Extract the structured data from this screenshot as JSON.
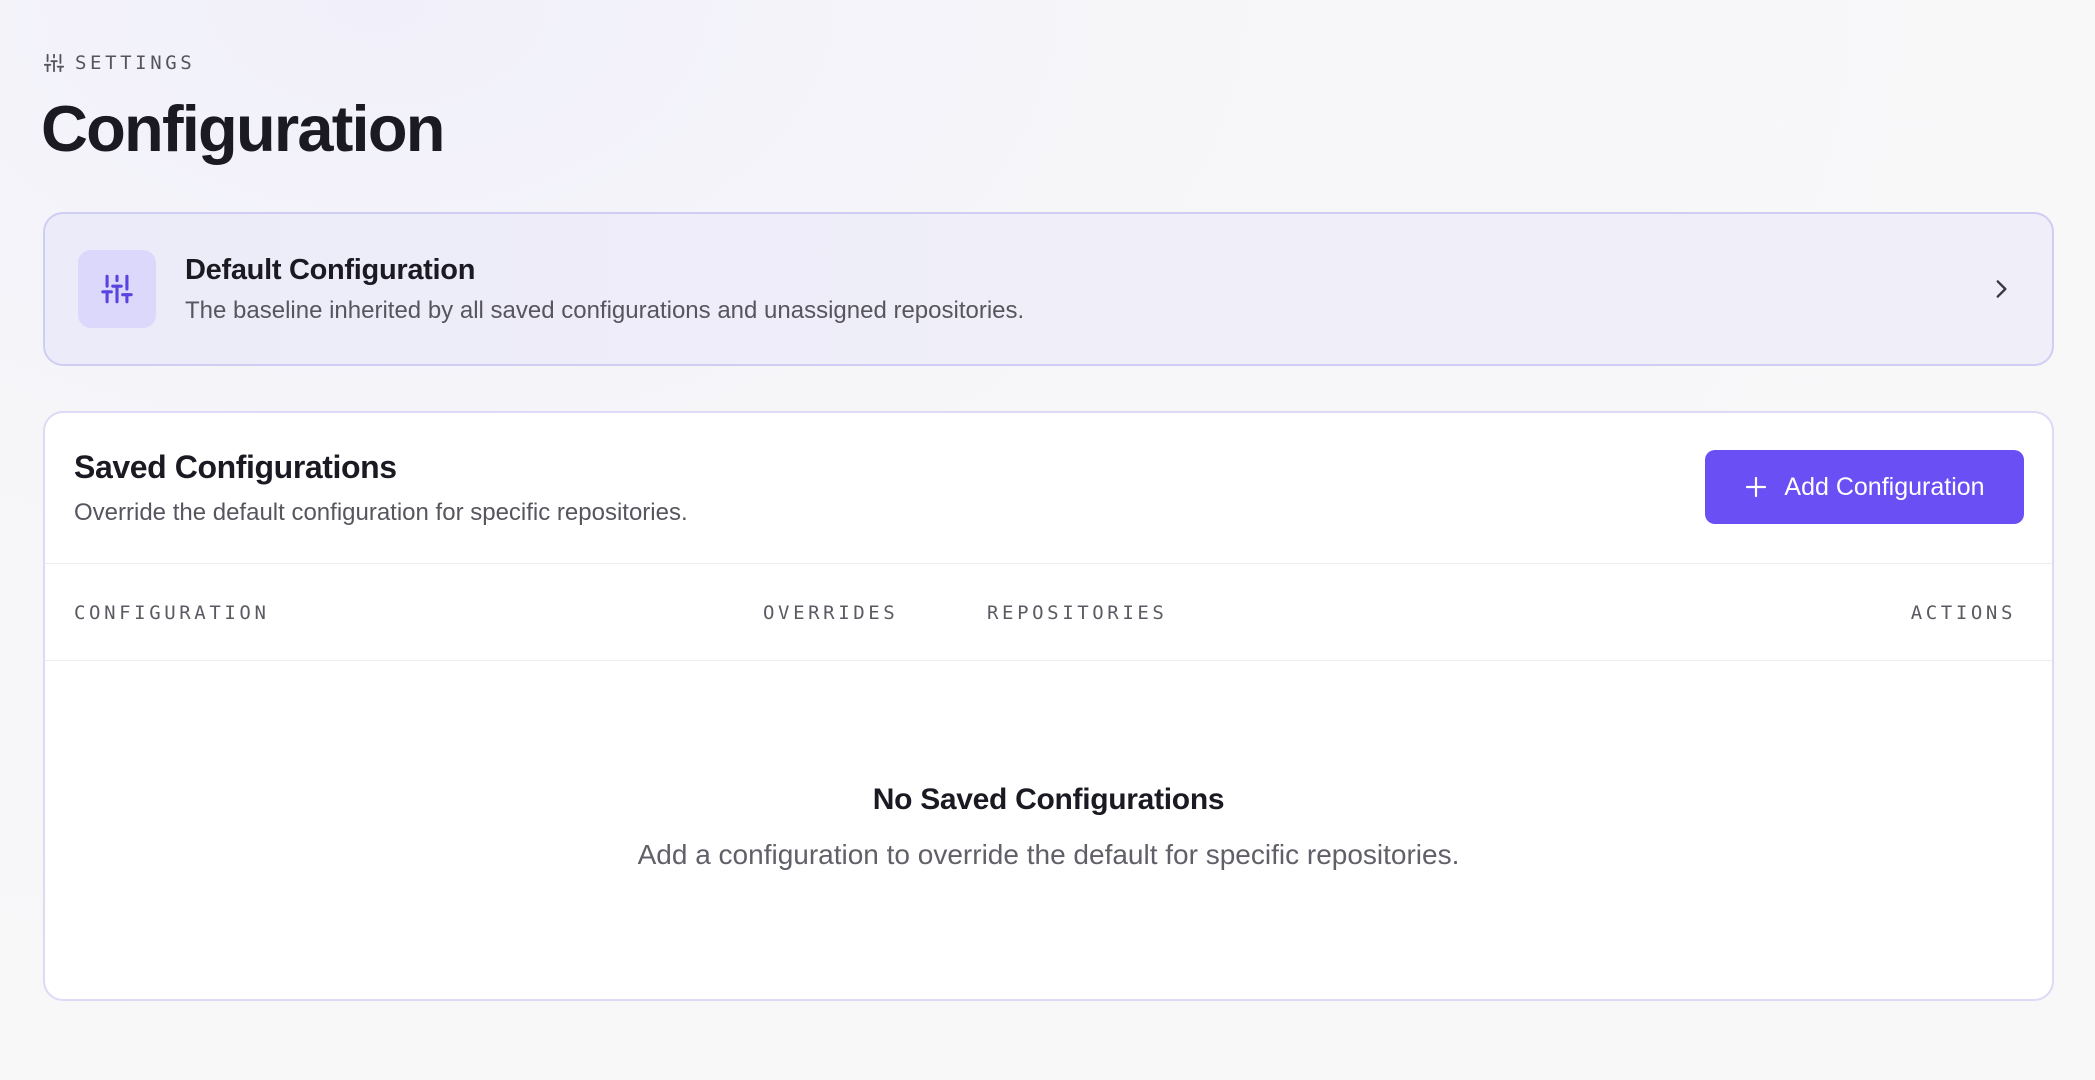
{
  "header": {
    "eyebrow": "SETTINGS",
    "eyebrow_icon": "sliders-icon",
    "title": "Configuration"
  },
  "default_card": {
    "icon": "sliders-icon",
    "title": "Default Configuration",
    "description": "The baseline inherited by all saved configurations and unassigned repositories.",
    "chevron_icon": "chevron-right-icon"
  },
  "saved": {
    "title": "Saved Configurations",
    "description": "Override the default configuration for specific repositories.",
    "add_button": {
      "icon": "plus-icon",
      "label": "Add Configuration"
    },
    "columns": [
      "CONFIGURATION",
      "OVERRIDES",
      "REPOSITORIES",
      "ACTIONS"
    ],
    "rows": [],
    "empty_state": {
      "title": "No Saved Configurations",
      "description": "Add a configuration to override the default for specific repositories."
    }
  },
  "colors": {
    "accent": "#6a4ff5",
    "accent_light": "#dcd8fb",
    "card_border": "#d0cdf5",
    "text_primary": "#1b1a22",
    "text_secondary": "#57565e"
  }
}
